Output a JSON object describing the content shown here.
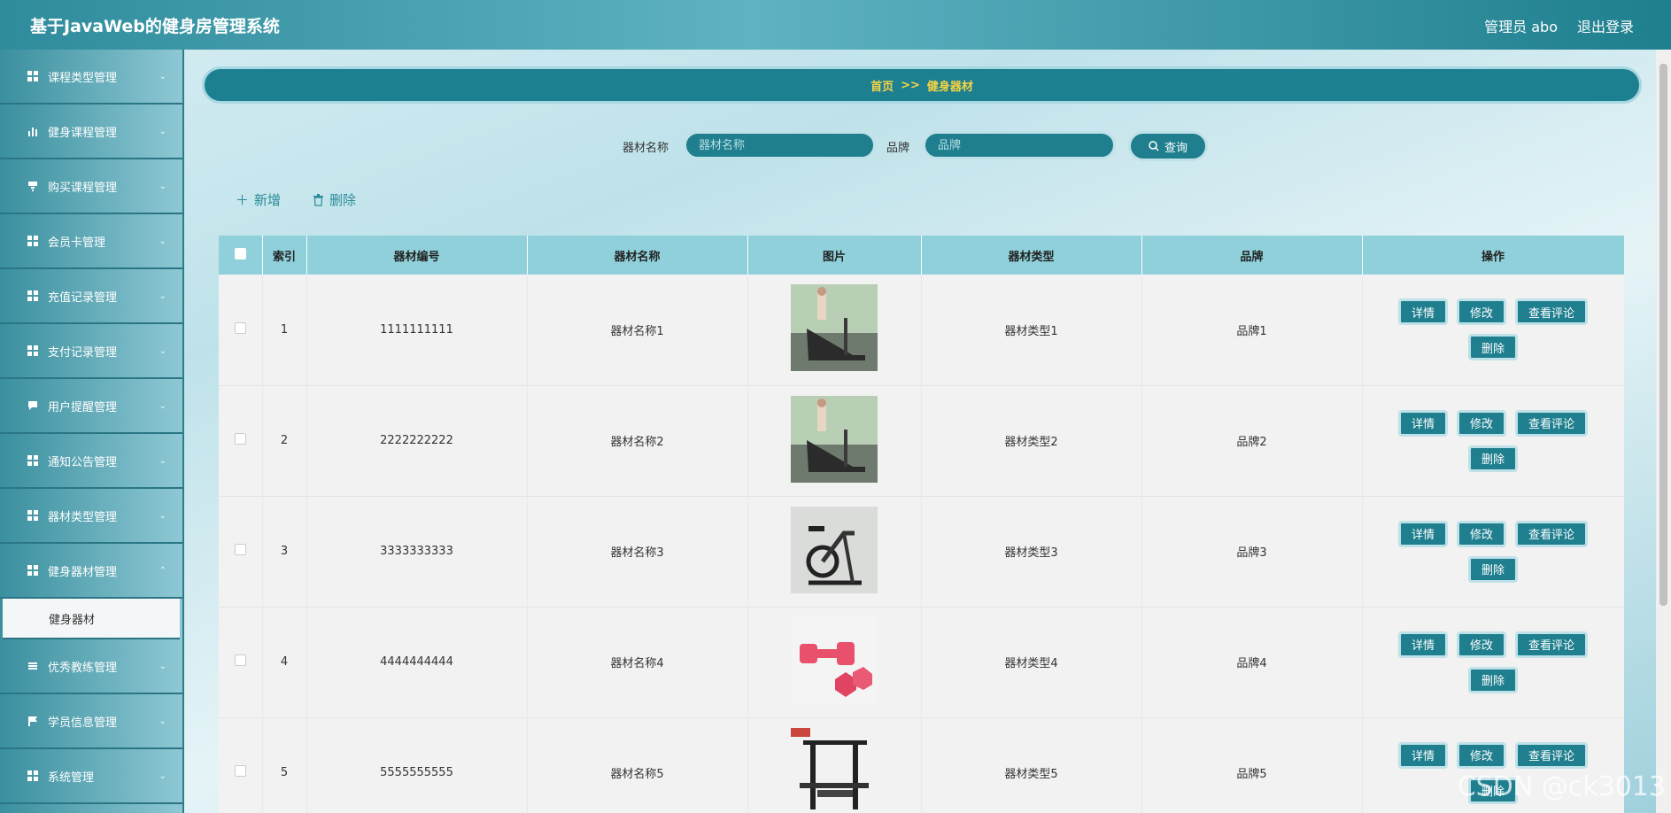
{
  "header": {
    "title": "基于JavaWeb的健身房管理系统",
    "user_label": "管理员 abo",
    "logout_label": "退出登录"
  },
  "sidebar": {
    "items": [
      {
        "label": "课程类型管理",
        "icon": "grid-icon"
      },
      {
        "label": "健身课程管理",
        "icon": "bar-chart-icon"
      },
      {
        "label": "购买课程管理",
        "icon": "cart-icon"
      },
      {
        "label": "会员卡管理",
        "icon": "grid-icon"
      },
      {
        "label": "充值记录管理",
        "icon": "grid-icon"
      },
      {
        "label": "支付记录管理",
        "icon": "grid-icon"
      },
      {
        "label": "用户提醒管理",
        "icon": "message-icon"
      },
      {
        "label": "通知公告管理",
        "icon": "grid-icon"
      },
      {
        "label": "器材类型管理",
        "icon": "grid-icon"
      },
      {
        "label": "健身器材管理",
        "icon": "grid-icon"
      }
    ],
    "active_sub": "健身器材",
    "items_after": [
      {
        "label": "优秀教练管理",
        "icon": "list-icon"
      },
      {
        "label": "学员信息管理",
        "icon": "flag-icon"
      },
      {
        "label": "系统管理",
        "icon": "grid-icon"
      }
    ]
  },
  "breadcrumb": {
    "home": "首页",
    "separator": ">>",
    "current": "健身器材"
  },
  "search": {
    "name_label": "器材名称",
    "name_placeholder": "器材名称",
    "brand_label": "品牌",
    "brand_placeholder": "品牌",
    "query_label": "查询"
  },
  "toolbar": {
    "add_label": "新增",
    "delete_label": "删除"
  },
  "table": {
    "columns": [
      "索引",
      "器材编号",
      "器材名称",
      "图片",
      "器材类型",
      "品牌",
      "操作"
    ],
    "rows": [
      {
        "index": "1",
        "code": "1111111111",
        "name": "器材名称1",
        "image": "treadmill",
        "type": "器材类型1",
        "brand": "品牌1"
      },
      {
        "index": "2",
        "code": "2222222222",
        "name": "器材名称2",
        "image": "treadmill",
        "type": "器材类型2",
        "brand": "品牌2"
      },
      {
        "index": "3",
        "code": "3333333333",
        "name": "器材名称3",
        "image": "exercise-bike",
        "type": "器材类型3",
        "brand": "品牌3"
      },
      {
        "index": "4",
        "code": "4444444444",
        "name": "器材名称4",
        "image": "dumbbell",
        "type": "器材类型4",
        "brand": "品牌4"
      },
      {
        "index": "5",
        "code": "5555555555",
        "name": "器材名称5",
        "image": "power-rack",
        "type": "器材类型5",
        "brand": "品牌5"
      }
    ],
    "actions": {
      "detail": "详情",
      "edit": "修改",
      "comments": "查看评论",
      "delete": "删除"
    }
  },
  "watermark": "CSDN @ck3013",
  "colors": {
    "accent": "#1f7f8f",
    "breadcrumb_text": "#f7d442",
    "table_header": "#8fd0da"
  }
}
